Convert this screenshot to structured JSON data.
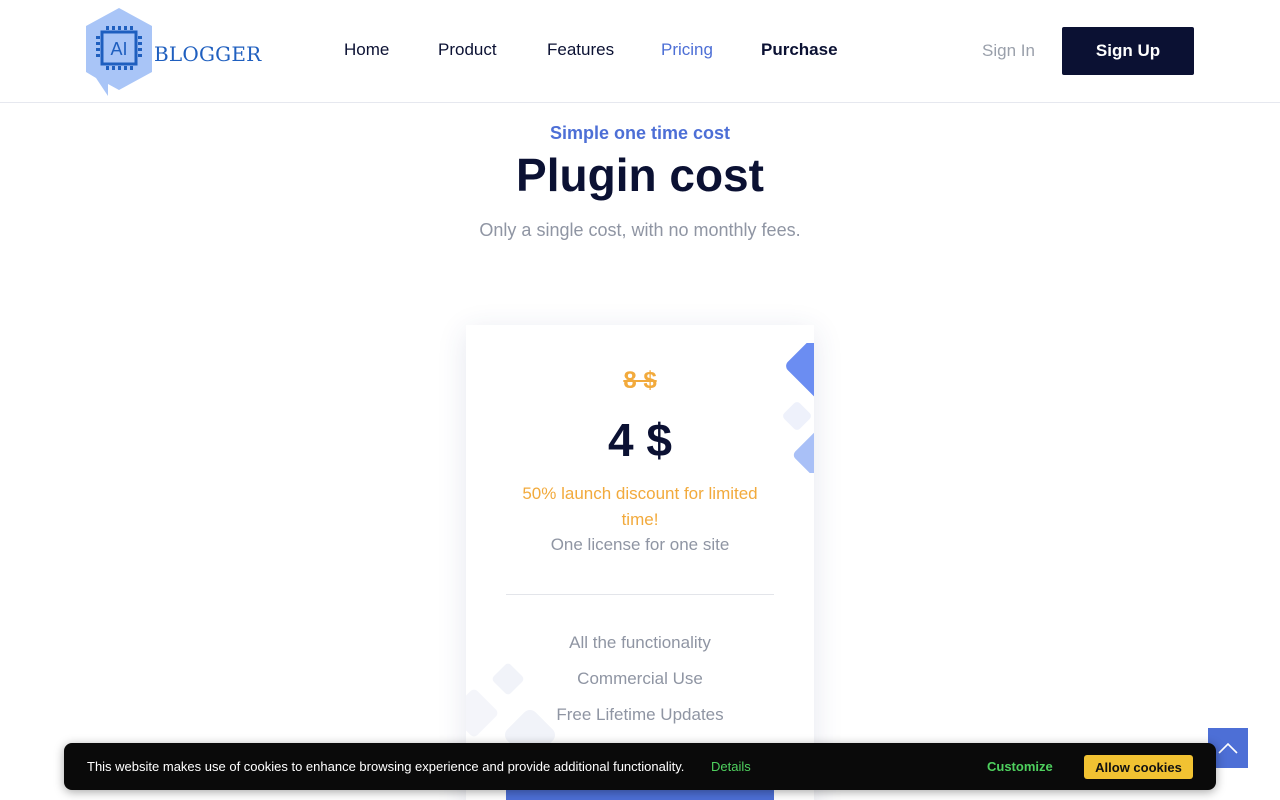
{
  "header": {
    "logo_text": "BLOGGER",
    "logo_badge": "AI",
    "nav": [
      {
        "label": "Home"
      },
      {
        "label": "Product"
      },
      {
        "label": "Features"
      },
      {
        "label": "Pricing"
      },
      {
        "label": "Purchase"
      }
    ],
    "sign_in": "Sign In",
    "sign_up": "Sign Up"
  },
  "hero": {
    "kicker": "Simple one time cost",
    "title": "Plugin cost",
    "subtitle": "Only a single cost, with no monthly fees."
  },
  "pricing_card": {
    "old_price": "8 $",
    "price": "4 $",
    "discount_note": "50% launch discount for limited time!",
    "license": "One license for one site",
    "features": [
      "All the functionality",
      "Commercial Use",
      "Free Lifetime Updates"
    ]
  },
  "cookie_banner": {
    "message": "This website makes use of cookies to enhance browsing experience and provide additional functionality.",
    "details": "Details",
    "customize": "Customize",
    "allow": "Allow cookies"
  },
  "colors": {
    "primary": "#0b1133",
    "accent": "#4d6fd6",
    "discount": "#f2aa3c",
    "cookie_green": "#4ed05e",
    "cookie_yellow": "#f1c232"
  },
  "icons": {
    "logo": "ai-chip-hexagon-icon",
    "scroll_top": "chevron-up-icon"
  }
}
